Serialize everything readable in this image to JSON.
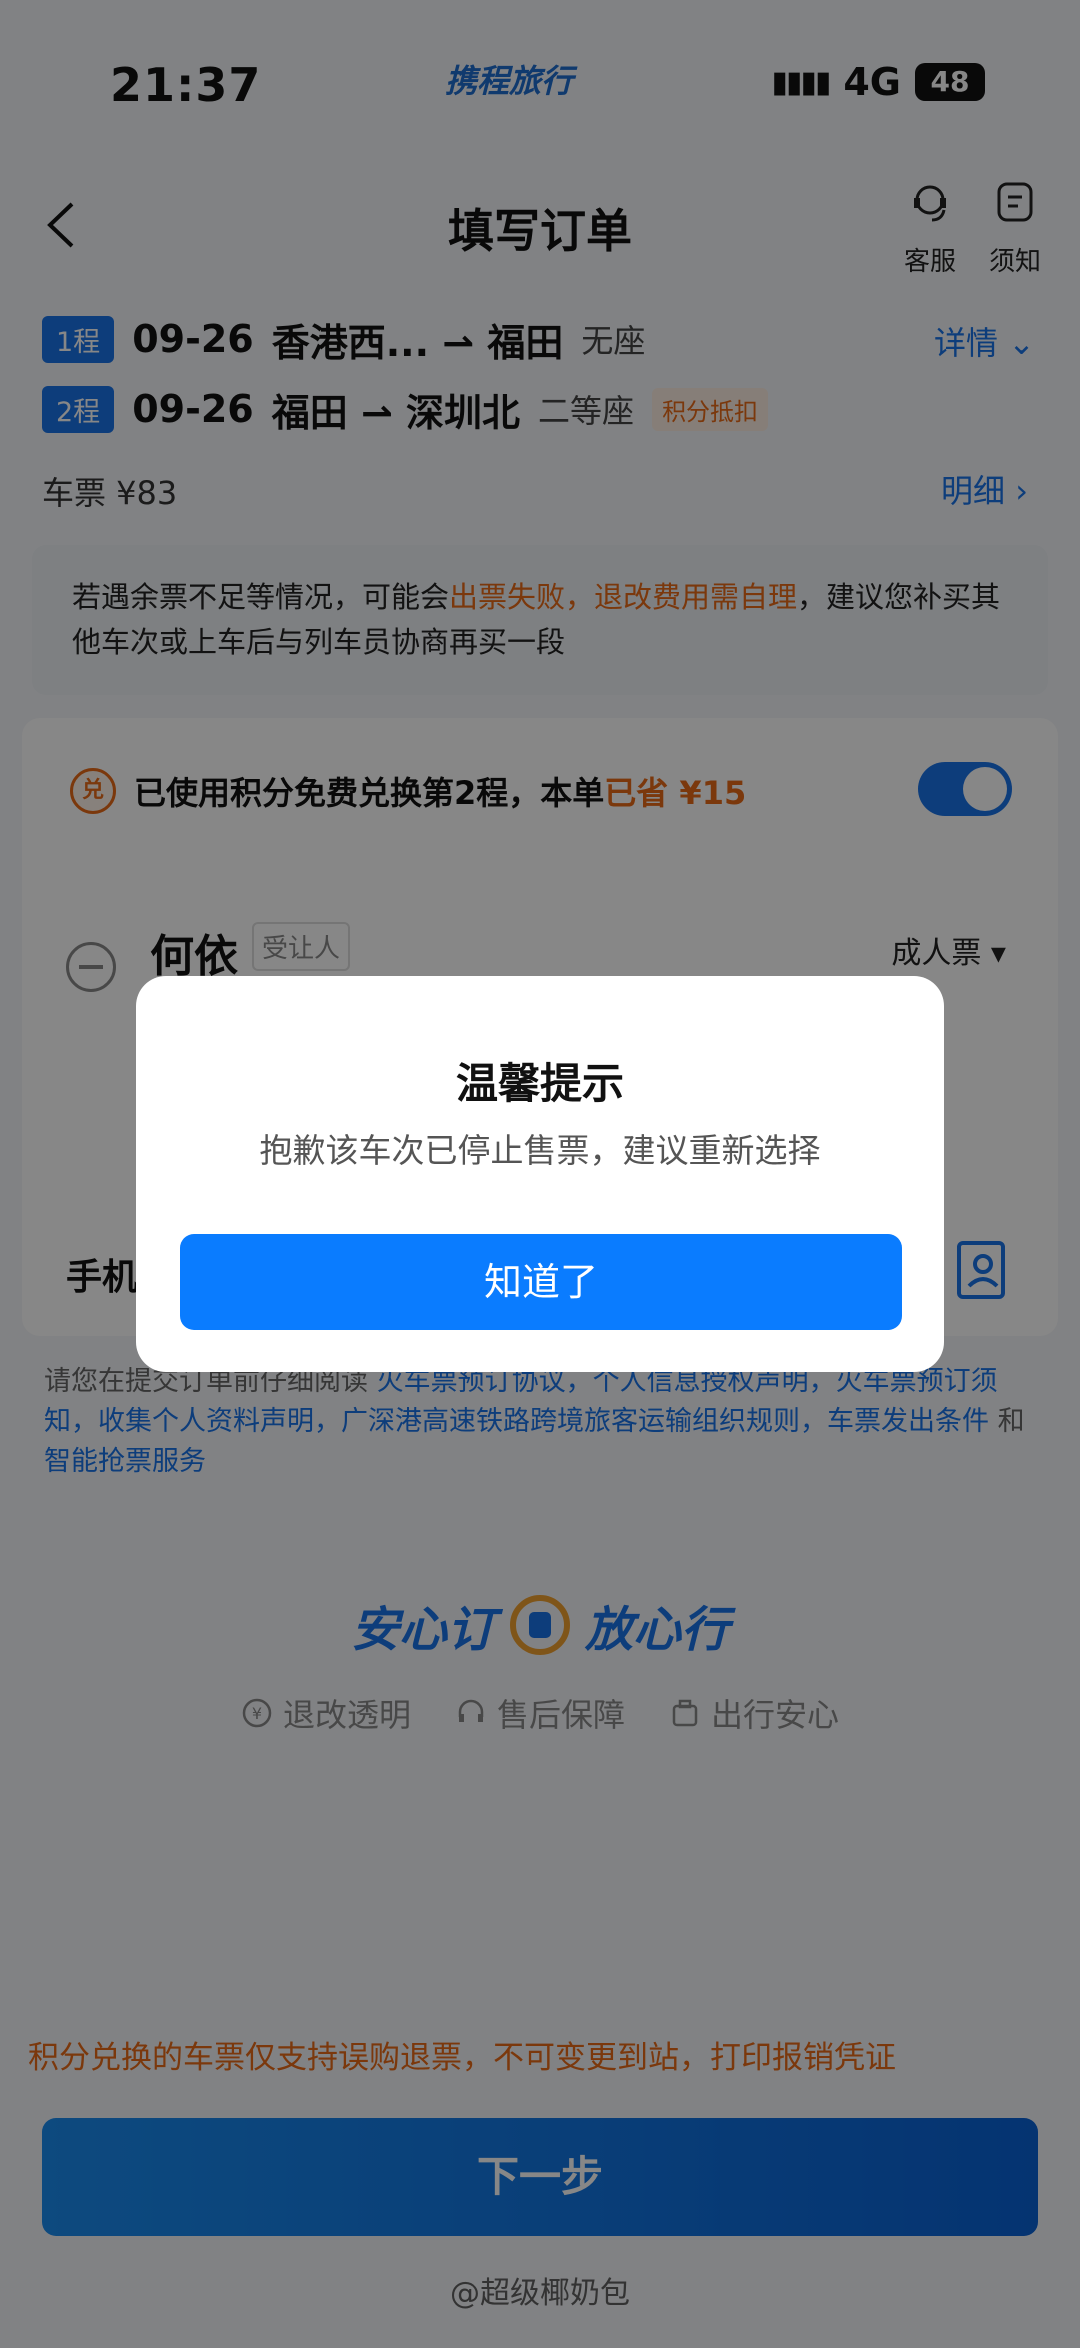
{
  "status_bar": {
    "time": "21:37",
    "app_label": "携程旅行",
    "network": "4G",
    "battery": "48"
  },
  "header": {
    "title": "填写订单",
    "service_label": "客服",
    "notice_label": "须知"
  },
  "trips": [
    {
      "badge": "1程",
      "date": "09-26",
      "route": "香港西... ⇀ 福田",
      "seat": "无座",
      "tag": ""
    },
    {
      "badge": "2程",
      "date": "09-26",
      "route": "福田 ⇀ 深圳北",
      "seat": "二等座",
      "tag": "积分抵扣"
    }
  ],
  "detail_link": "详情 ⌄",
  "fare": {
    "label": "车票 ¥83",
    "link": "明细 ›"
  },
  "notice": {
    "part1": "若遇余票不足等情况，可能会",
    "highlight": "出票失败，退改费用需自理",
    "part2": "，建议您补买其他车次或上车后与列车员协商再买一段"
  },
  "redeem": {
    "icon_text": "兑",
    "text": "已使用积分免费兑换第2程，本单",
    "saved": "已省 ¥15",
    "enabled": true
  },
  "passenger": {
    "name": "何依",
    "tag": "受让人",
    "type": "成人票 ▾"
  },
  "phone_label": "手机",
  "agreement": {
    "prefix": "请您在提交订单前仔细阅读",
    "links": "火车票预订协议，个人信息授权声明，火车票预订须知，收集个人资料声明，广深港高速铁路跨境旅客运输组织规则，车票发出条件",
    "and": " 和 ",
    "last": "智能抢票服务"
  },
  "slogan": {
    "left": "安心订",
    "right": "放心行"
  },
  "features": [
    "退改透明",
    "售后保障",
    "出行安心"
  ],
  "bottom_note": "积分兑换的车票仅支持误购退票，不可变更到站，打印报销凭证",
  "next_button": "下一步",
  "watermark": "@超级椰奶包",
  "dialog": {
    "title": "温馨提示",
    "message": "抱歉该车次已停止售票，建议重新选择",
    "button": "知道了"
  },
  "colors": {
    "accent": "#1a73e8",
    "highlight": "#e86a17",
    "dialog_button": "#0a7cff"
  }
}
